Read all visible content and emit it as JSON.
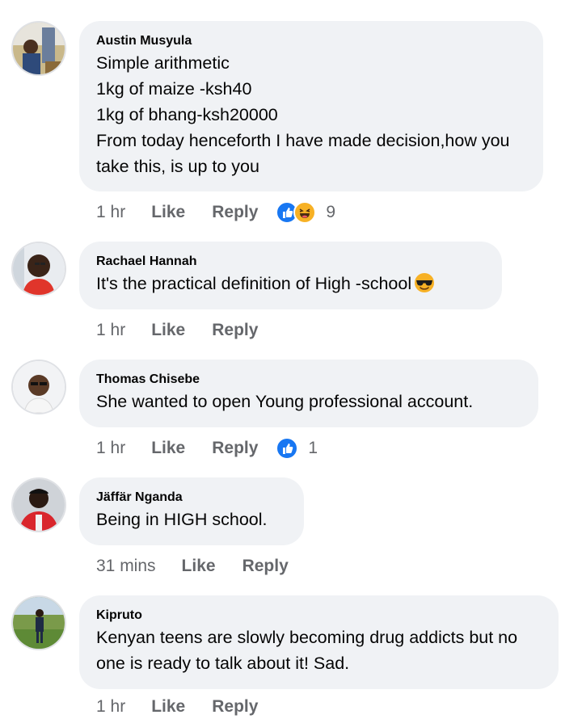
{
  "comments": [
    {
      "author": "Austin Musyula",
      "text": "Simple arithmetic\n1kg of maize -ksh40\n1kg of bhang-ksh20000\nFrom today henceforth I have made decision,how you take this, is up to you",
      "time": "1 hr",
      "like_label": "Like",
      "reply_label": "Reply",
      "reactions": [
        "like-icon",
        "haha-icon"
      ],
      "reaction_count": "9"
    },
    {
      "author": "Rachael Hannah",
      "text": "It's the practical definition of High -school",
      "emoji": "sunglasses-face-icon",
      "time": "1 hr",
      "like_label": "Like",
      "reply_label": "Reply"
    },
    {
      "author": "Thomas Chisebe",
      "text": "She wanted to open Young professional account.",
      "time": "1 hr",
      "like_label": "Like",
      "reply_label": "Reply",
      "reactions": [
        "like-icon"
      ],
      "reaction_count": "1"
    },
    {
      "author": "Jäffär Nganda",
      "text": "Being in HIGH school.",
      "time": "31 mins",
      "like_label": "Like",
      "reply_label": "Reply"
    },
    {
      "author": "Kipruto",
      "text": "Kenyan teens are slowly becoming drug addicts but no one is ready to talk about it! Sad.",
      "time": "1 hr",
      "like_label": "Like",
      "reply_label": "Reply"
    }
  ],
  "colors": {
    "bubble_bg": "#f0f2f5",
    "meta_text": "#65676b",
    "like_blue": "#1877f2",
    "haha_yellow": "#f7b125"
  }
}
